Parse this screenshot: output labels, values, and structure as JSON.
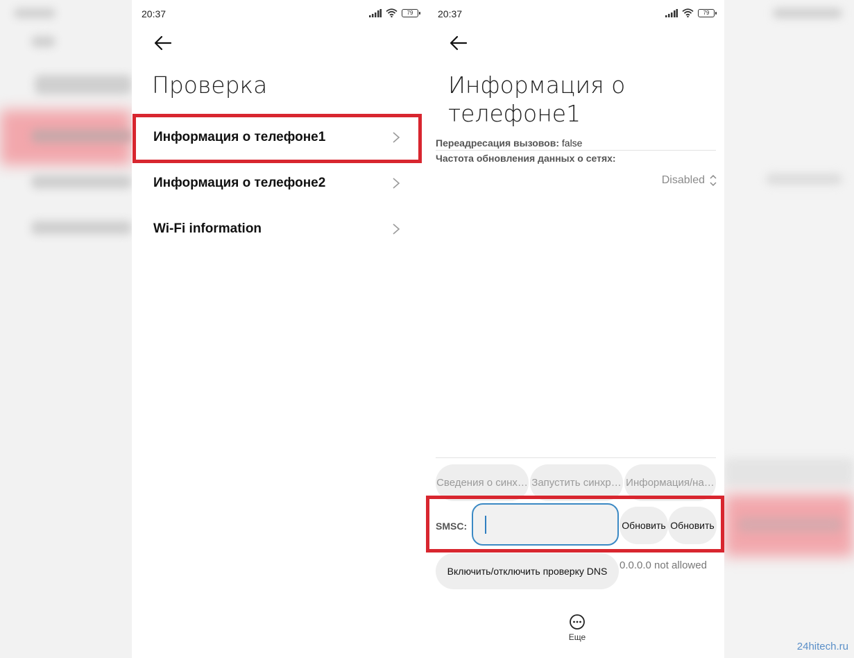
{
  "colors": {
    "highlight": "#d8262f",
    "input_border": "#3b89c4",
    "link": "#5a8fc8"
  },
  "status": {
    "time_left": "20:37",
    "time_right": "20:37",
    "battery": "79"
  },
  "left_screen": {
    "title": "Проверка",
    "items": [
      {
        "label": "Информация о телефоне1",
        "icon": "chevron-right-icon"
      },
      {
        "label": "Информация о телефоне2",
        "icon": "chevron-right-icon"
      },
      {
        "label": "Wi-Fi information",
        "icon": "chevron-right-icon"
      }
    ]
  },
  "right_screen": {
    "title_line1": "Информация о",
    "title_line2": "телефоне1",
    "call_forward_label": "Переадресация вызовов:",
    "call_forward_value": "false",
    "refresh_rate_label": "Частота обновления данных о сетях:",
    "refresh_rate_value": "Disabled",
    "buttons_row": [
      "Сведения о синх…",
      "Запустить синхр…",
      "Информация/на…"
    ],
    "smsc_label": "SMSC:",
    "smsc_value": "",
    "update_button_1": "Обновить",
    "update_button_2": "Обновить",
    "dns_button": "Включить/отключить проверку DNS",
    "dns_value": "0.0.0.0 not allowed",
    "more_label": "Еще"
  },
  "watermark": "24hitech.ru"
}
